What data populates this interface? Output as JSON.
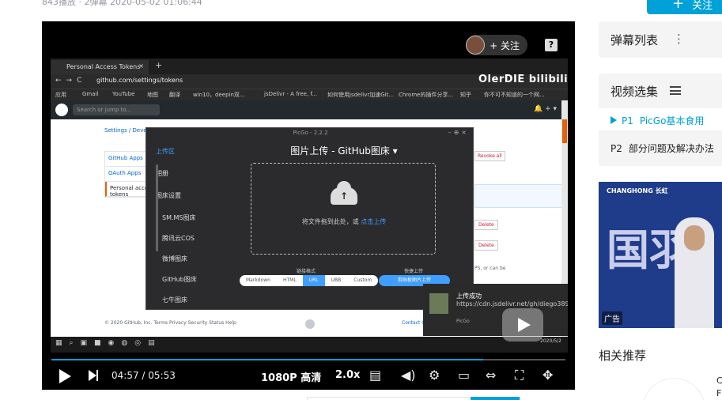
{
  "meta": {
    "stats": "843播放 · 2弹幕   2020-05-02 01:06:44"
  },
  "follow_top": {
    "label": "关注"
  },
  "player": {
    "uploader_follow": "+ 关注",
    "help": "?",
    "watermark": "OlerDIE bilibili",
    "time_current": "04:57",
    "time_total": "05:53",
    "time_sep": "/",
    "quality": "1080P 高清",
    "speed": "2.0x",
    "progress": 0.84
  },
  "browser": {
    "tab_title": "Personal Access Tokens",
    "url": "github.com/settings/tokens",
    "bookmarks": [
      "应用",
      "Gmail",
      "YouTube",
      "地图",
      "翻译",
      "win10，deepin双...",
      "jsDelivr - A free, f...",
      "如何使用jsdelivr加速Git...",
      "Chrome的插件分享...",
      "知乎",
      "你不可不知道的一个网..."
    ],
    "gh_search_placeholder": "Search or jump to...",
    "gh_right": "🔔 + ▾",
    "crumb": "Settings / Developer settings",
    "side_menu": [
      "GitHub Apps",
      "OAuth Apps",
      "Personal access tokens"
    ],
    "revoke_label": "Revoke all",
    "delete_label": "Delete",
    "can_be": "PS, or can be",
    "footer_left": "© 2020 GitHub, Inc.  Terms  Privacy  Security  Status  Help",
    "footer_right": "Contact GitHub",
    "taskbar_time": "2020/5/2"
  },
  "picgo": {
    "title": "PicGo - 2.2.2",
    "nav": [
      "上传区",
      "相册",
      "图床设置",
      "SM.MS图床",
      "腾讯云COS",
      "微博图床",
      "GitHub图床",
      "七牛图床"
    ],
    "heading": "图片上传 - GitHub图床 ▾",
    "drop_text": "将文件拖到此处，或 ",
    "drop_link": "点击上传",
    "link_format_label": "链接格式",
    "quick_upload_label": "快捷上传",
    "formats": [
      "Markdown",
      "HTML",
      "URL",
      "UBB",
      "Custom"
    ],
    "active_format": "URL",
    "quick_button": "剪贴板图片上传"
  },
  "toast": {
    "title": "上传成功",
    "body": "https://cdn.jsdelivr.net/gh/diego3893/image/bc...",
    "app": "PicGo"
  },
  "sidebar": {
    "danmaku_title": "弹幕列表",
    "collection_title": "视频选集",
    "episodes": [
      {
        "no": "P1",
        "title": "PicGo基本食用",
        "active": true
      },
      {
        "no": "P2",
        "title": "部分问题及解决办法",
        "active": false
      }
    ],
    "ad_brand": "CHANGHONG 长虹",
    "ad_text": "国羽",
    "ad_badge": "广告",
    "recommend_title": "相关推荐",
    "rec_snippet": "C\nF"
  },
  "colors": {
    "accent": "#00a1d6",
    "picgo_blue": "#409eff"
  }
}
